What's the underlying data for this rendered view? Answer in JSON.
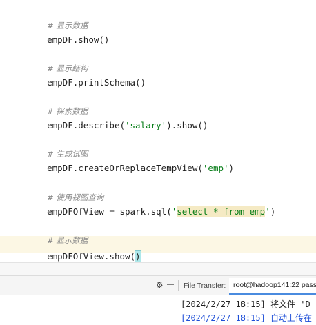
{
  "editor": {
    "lines": [
      {
        "comment": "# 显示数据",
        "code": "empDF.show()"
      },
      {
        "comment": "# 显示结构",
        "code": "empDF.printSchema()"
      },
      {
        "comment": "# 探索数据",
        "code_pre": "empDF.describe(",
        "code_str": "'salary'",
        "code_post": ").show()"
      },
      {
        "comment": "# 生成试图",
        "code_pre": "empDF.createOrReplaceTempView(",
        "code_str": "'emp'",
        "code_post": ")"
      },
      {
        "comment": "# 使用视图查询",
        "code_pre": "empDFOfView = spark.sql(",
        "code_str_q1": "'",
        "code_sel": "select * from emp",
        "code_str_q2": "'",
        "code_post": ")"
      },
      {
        "comment": "# 显示数据",
        "code_pre": "empDFOfView.show(",
        "code_paren": ")"
      }
    ]
  },
  "toolbar": {
    "settings_icon": "⚙",
    "minimize_icon": "—",
    "label": "File Transfer:",
    "tab": "root@hadoop141:22 pass"
  },
  "log": {
    "line1": "[2024/2/27 18:15] 将文件 'D",
    "line2": "[2024/2/27 18:15] 自动上传在"
  },
  "colors": {
    "comment": "#8c8c8c",
    "string": "#067d17",
    "log_blue": "#1e4fd8",
    "current_line": "#fcf7e4"
  }
}
